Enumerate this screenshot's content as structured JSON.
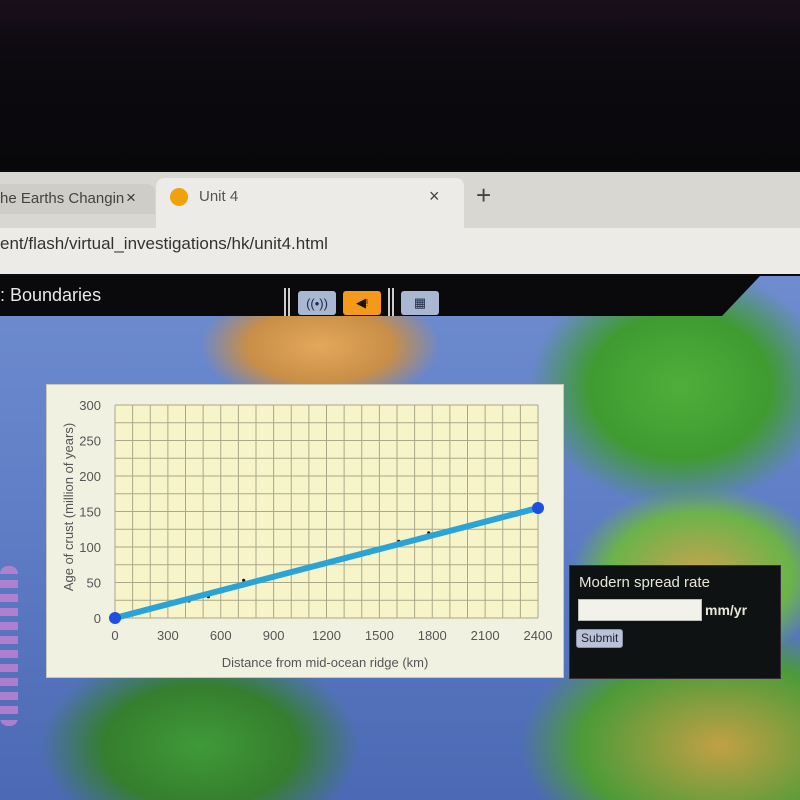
{
  "browser": {
    "tabs": [
      {
        "label": "he Earths Changin",
        "close_icon": "×"
      },
      {
        "label": "Unit 4",
        "close_icon": "×",
        "favicon_color": "#f0a20c",
        "active": true
      }
    ],
    "new_tab_icon": "+",
    "address": "ent/flash/virtual_investigations/hk/unit4.html"
  },
  "app": {
    "title": ": Boundaries",
    "toolbar": {
      "radio_icon": "((•))",
      "sound_icon": "◀ᵎ",
      "calculator_icon": "▦"
    },
    "accent_color": "#f39a1a"
  },
  "rate_panel": {
    "heading": "Modern spread rate",
    "input_value": "",
    "input_placeholder": "",
    "unit": "mm/yr",
    "submit_label": "Submit"
  },
  "chart_data": {
    "type": "line",
    "title": "",
    "xlabel": "Distance from mid-ocean ridge (km)",
    "ylabel": "Age of crust (million of years)",
    "xlim": [
      0,
      2400
    ],
    "ylim": [
      0,
      300
    ],
    "x_ticks": [
      0,
      300,
      600,
      900,
      1200,
      1500,
      1800,
      2100,
      2400
    ],
    "y_ticks": [
      0,
      50,
      100,
      150,
      200,
      250,
      300
    ],
    "x_tick_labels": [
      "0",
      "300",
      "600",
      "900",
      "1200",
      "1500",
      "1800",
      "2100",
      "2400"
    ],
    "y_tick_labels": [
      "0",
      "50",
      "100",
      "150",
      "200",
      "250",
      "300"
    ],
    "x_minor_step": 100,
    "y_minor_step": 25,
    "grid": true,
    "series": [
      {
        "name": "data points",
        "kind": "scatter",
        "color": "#1a1a1a",
        "points": [
          [
            420,
            24
          ],
          [
            530,
            30
          ],
          [
            730,
            53
          ],
          [
            1610,
            108
          ],
          [
            1780,
            120
          ],
          [
            2280,
            145
          ]
        ]
      },
      {
        "name": "best-fit line",
        "kind": "line",
        "color": "#2aa3d6",
        "endpoint_color": "#1f4fe0",
        "points": [
          [
            0,
            0
          ],
          [
            2400,
            155
          ]
        ]
      }
    ]
  }
}
